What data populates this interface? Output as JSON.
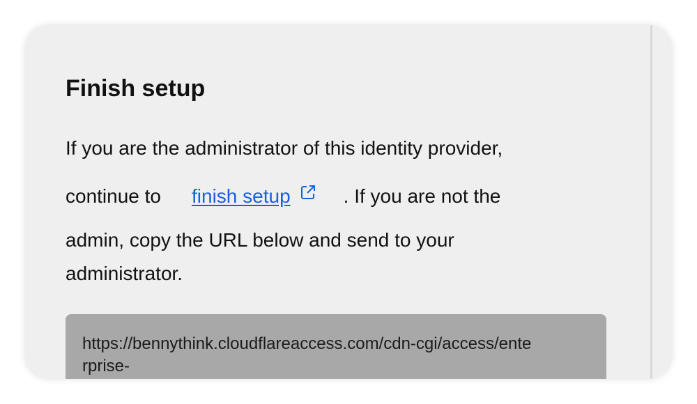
{
  "dialog": {
    "title": "Finish setup",
    "line1": "If you are the administrator of this identity provider,",
    "line2_before": "continue to",
    "link_label": "finish setup",
    "line2_after": ". If you are not the",
    "line3": "admin, copy the URL below and send to your",
    "line4": "administrator.",
    "url": "https://bennythink.cloudflareaccess.com/cdn-cgi/access/enterprise-"
  }
}
